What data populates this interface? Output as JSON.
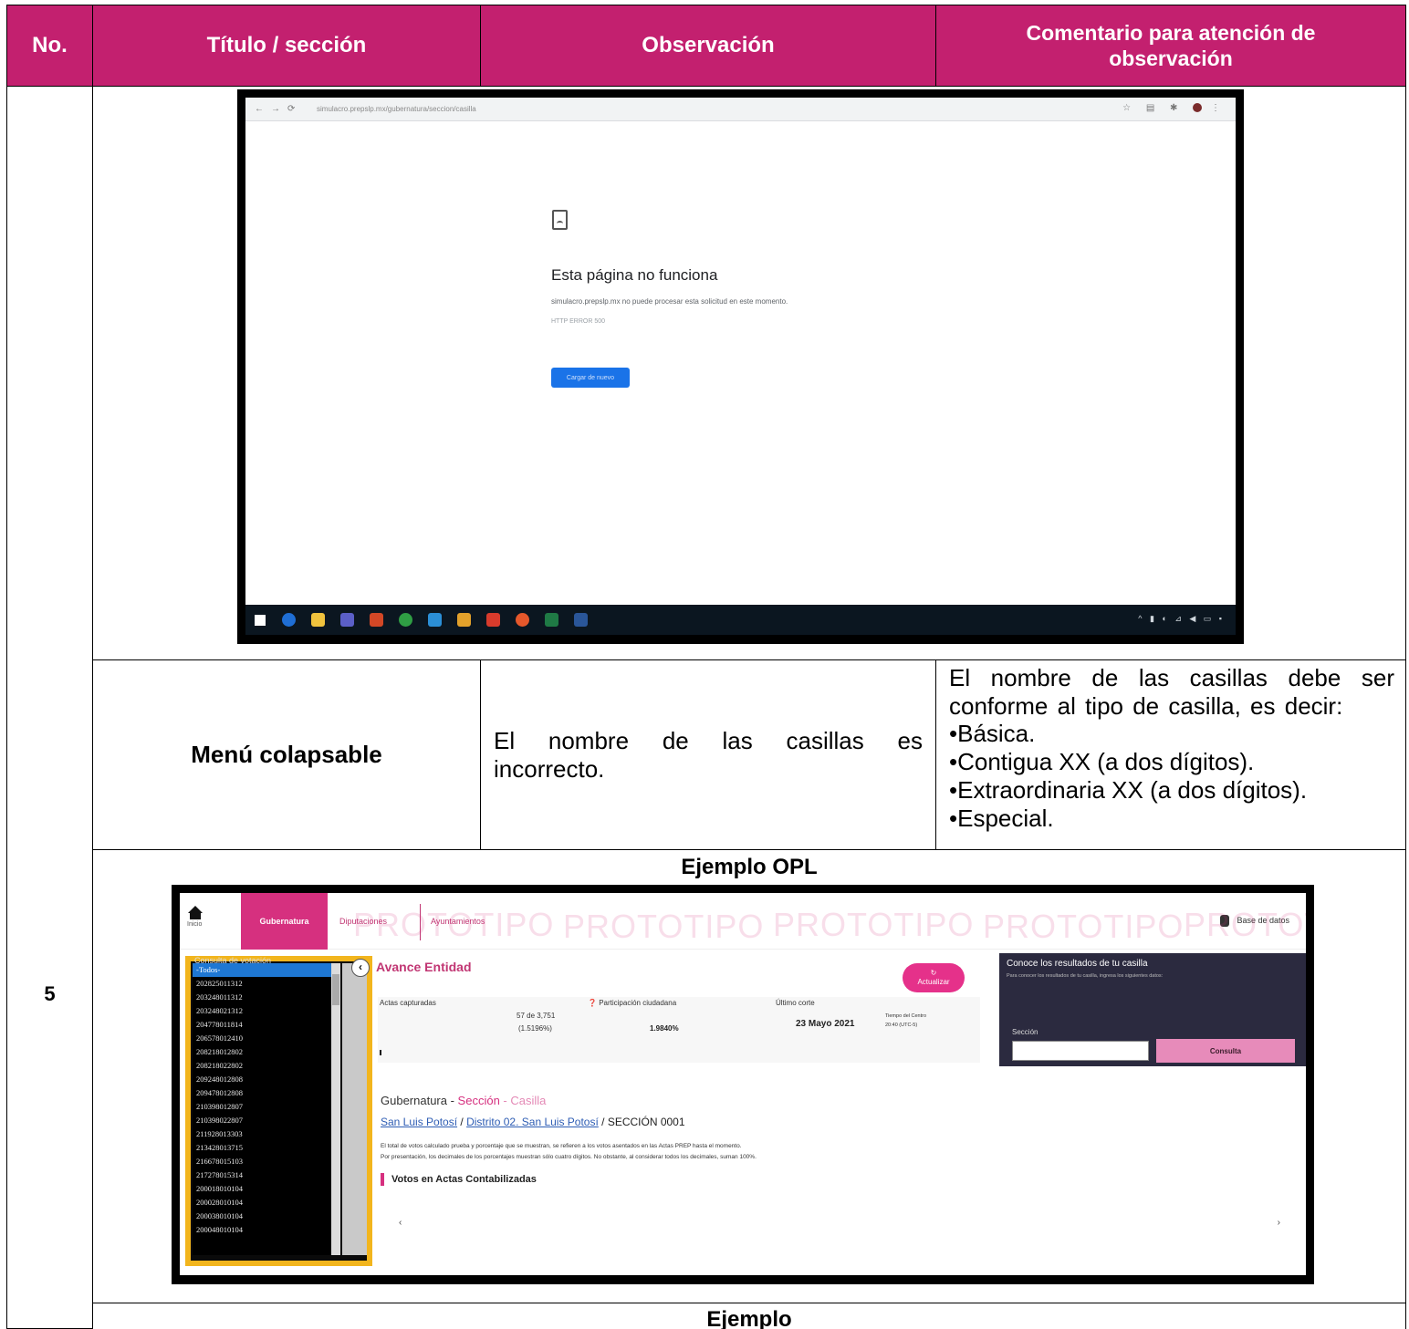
{
  "header": {
    "col_no": "No.",
    "col_titulo": "Título / sección",
    "col_observacion": "Observación",
    "col_comentario": "Comentario para atención de observación"
  },
  "screenshot_browser": {
    "error_title": "Esta página no funciona",
    "error_desc": "simulacro.prepslp.mx no puede procesar esta solicitud en este momento.",
    "error_code": "HTTP ERROR 500",
    "reload_button": "Cargar de nuevo"
  },
  "row": {
    "number": "5",
    "titulo": "Menú colapsable",
    "observacion": "El nombre de las casillas es incorrecto.",
    "comentario_intro": "El nombre de las casillas debe ser conforme al tipo de casilla, es decir:",
    "comentario_items": [
      "•Básica.",
      "•Contigua XX (a dos dígitos).",
      "•Extraordinaria XX (a dos dígitos).",
      "•Especial."
    ]
  },
  "ejemplo_opl_label": "Ejemplo OPL",
  "ejemplo_label": "Ejemplo",
  "screenshot_prep": {
    "home_label": "Inicio",
    "tabs": [
      "Gubernatura",
      "Diputaciones",
      "Ayuntamientos"
    ],
    "watermark": "PROTOTIPO",
    "db_link": "Base de datos",
    "sidebar_title": "Consulta de votación",
    "casillas": [
      "-Todos-",
      "202825011312",
      "203248011312",
      "203248021312",
      "204778011814",
      "206578012410",
      "208218012802",
      "208218022802",
      "209248012808",
      "209478012808",
      "210398012807",
      "210398022807",
      "211928013303",
      "213428013715",
      "216678015103",
      "217278015314",
      "200018010104",
      "200028010104",
      "200038010104",
      "200048010104"
    ],
    "avance_title": "Avance Entidad",
    "actualizar_btn": "Actualizar",
    "actas_label": "Actas capturadas",
    "actas_value": "57 de 3,751",
    "actas_pct": "(1.5196%)",
    "participacion_label": "Participación ciudadana",
    "participacion_value": "1.9840%",
    "corte_label": "Último corte",
    "corte_value": "23 Mayo 2021",
    "corte_hora_label": "Tiempo del Centro",
    "corte_hora": "20:40 (UTC-5)",
    "panel_title": "Conoce los resultados de tu casilla",
    "panel_sub": "Para conocer los resultados de tu casilla, ingresa los siguientes datos:",
    "seccion_label": "Sección",
    "consulta_btn": "Consulta",
    "crumb_part1": "Gubernatura - ",
    "crumb_part2": "Sección",
    "crumb_part3": " - Casilla",
    "bc_link1": "San Luis Potosí",
    "bc_sep1": " / ",
    "bc_link2": "Distrito 02. San Luis Potosí",
    "bc_rest": " / SECCIÓN 0001",
    "note_line1": "El total de votos calculado prueba y porcentaje que se muestran, se refieren a los votos asentados en las Actas PREP hasta el momento.",
    "note_line2": "Por presentación, los decimales de los porcentajes muestran sólo cuatro dígitos. No obstante, al considerar todos los decimales, suman 100%.",
    "votos_title": "Votos en Actas Contabilizadas"
  },
  "colors": {
    "header_bg": "#c3206f",
    "accent_pink": "#d6307f",
    "highlight_box": "#f2b51d"
  }
}
